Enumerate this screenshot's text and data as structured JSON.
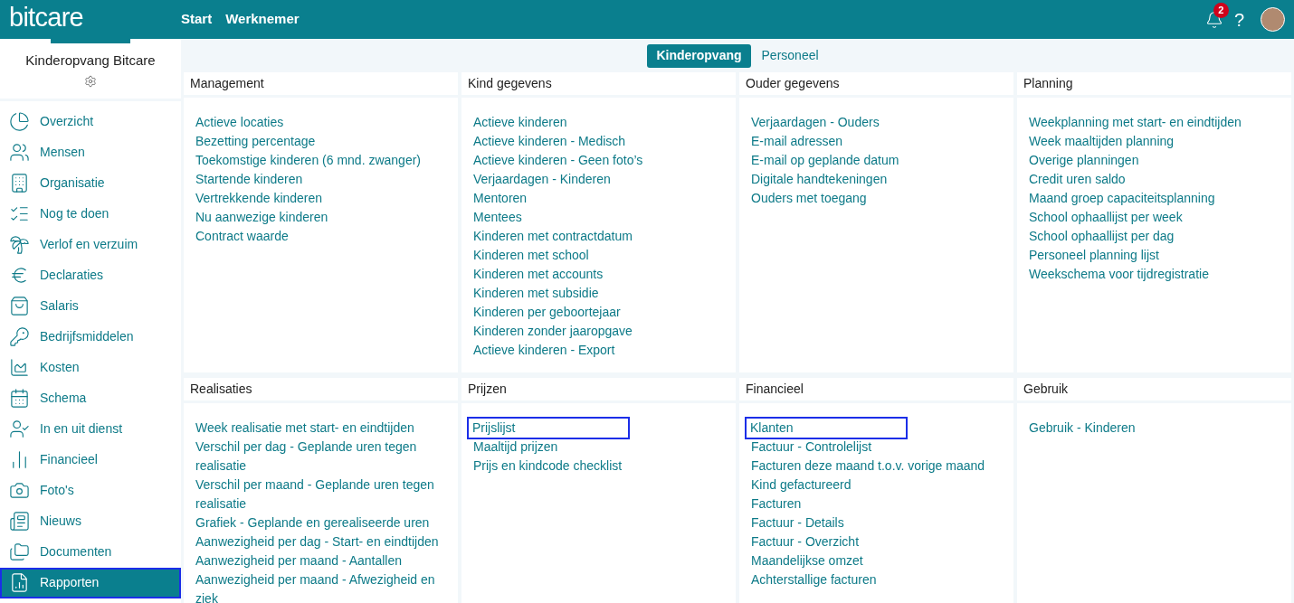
{
  "header": {
    "logo": "bitcare",
    "nav": [
      {
        "label": "Start"
      },
      {
        "label": "Werknemer"
      }
    ],
    "notifications": "2",
    "help": "?"
  },
  "sidebar": {
    "organisation": "Kinderopvang Bitcare",
    "items": [
      {
        "label": "Overzicht",
        "selected": false,
        "highlighted": false
      },
      {
        "label": "Mensen",
        "selected": false,
        "highlighted": false
      },
      {
        "label": "Organisatie",
        "selected": false,
        "highlighted": false
      },
      {
        "label": "Nog te doen",
        "selected": false,
        "highlighted": false
      },
      {
        "label": "Verlof en verzuim",
        "selected": false,
        "highlighted": false
      },
      {
        "label": "Declaraties",
        "selected": false,
        "highlighted": false
      },
      {
        "label": "Salaris",
        "selected": false,
        "highlighted": false
      },
      {
        "label": "Bedrijfsmiddelen",
        "selected": false,
        "highlighted": false
      },
      {
        "label": "Kosten",
        "selected": false,
        "highlighted": false
      },
      {
        "label": "Schema",
        "selected": false,
        "highlighted": false
      },
      {
        "label": "In en uit dienst",
        "selected": false,
        "highlighted": false
      },
      {
        "label": "Financieel",
        "selected": false,
        "highlighted": false
      },
      {
        "label": "Foto's",
        "selected": false,
        "highlighted": false
      },
      {
        "label": "Nieuws",
        "selected": false,
        "highlighted": false
      },
      {
        "label": "Documenten",
        "selected": false,
        "highlighted": false
      },
      {
        "label": "Rapporten",
        "selected": true,
        "highlighted": true
      }
    ]
  },
  "tabs": [
    {
      "label": "Kinderopvang",
      "selected": true
    },
    {
      "label": "Personeel",
      "selected": false
    }
  ],
  "panels": [
    {
      "title": "Management",
      "links": [
        {
          "label": "Actieve locaties",
          "highlighted": false
        },
        {
          "label": "Bezetting percentage",
          "highlighted": false
        },
        {
          "label": "Toekomstige kinderen (6 mnd. zwanger)",
          "highlighted": false
        },
        {
          "label": "Startende kinderen",
          "highlighted": false
        },
        {
          "label": "Vertrekkende kinderen",
          "highlighted": false
        },
        {
          "label": "Nu aanwezige kinderen",
          "highlighted": false
        },
        {
          "label": "Contract waarde",
          "highlighted": false
        }
      ]
    },
    {
      "title": "Kind gegevens",
      "links": [
        {
          "label": "Actieve kinderen",
          "highlighted": false
        },
        {
          "label": "Actieve kinderen - Medisch",
          "highlighted": false
        },
        {
          "label": "Actieve kinderen - Geen foto’s",
          "highlighted": false
        },
        {
          "label": "Verjaardagen - Kinderen",
          "highlighted": false
        },
        {
          "label": "Mentoren",
          "highlighted": false
        },
        {
          "label": "Mentees",
          "highlighted": false
        },
        {
          "label": "Kinderen met contractdatum",
          "highlighted": false
        },
        {
          "label": "Kinderen met school",
          "highlighted": false
        },
        {
          "label": "Kinderen met accounts",
          "highlighted": false
        },
        {
          "label": "Kinderen met subsidie",
          "highlighted": false
        },
        {
          "label": "Kinderen per geboortejaar",
          "highlighted": false
        },
        {
          "label": "Kinderen zonder jaaropgave",
          "highlighted": false
        },
        {
          "label": "Actieve kinderen - Export",
          "highlighted": false
        }
      ]
    },
    {
      "title": "Ouder gegevens",
      "links": [
        {
          "label": "Verjaardagen - Ouders",
          "highlighted": false
        },
        {
          "label": "E-mail adressen",
          "highlighted": false
        },
        {
          "label": "E-mail op geplande datum",
          "highlighted": false
        },
        {
          "label": "Digitale handtekeningen",
          "highlighted": false
        },
        {
          "label": "Ouders met toegang",
          "highlighted": false
        }
      ]
    },
    {
      "title": "Planning",
      "links": [
        {
          "label": "Weekplanning met start- en eindtijden",
          "highlighted": false
        },
        {
          "label": "Week maaltijden planning",
          "highlighted": false
        },
        {
          "label": "Overige planningen",
          "highlighted": false
        },
        {
          "label": "Credit uren saldo",
          "highlighted": false
        },
        {
          "label": "Maand groep capaciteitsplanning",
          "highlighted": false
        },
        {
          "label": "School ophaallijst per week",
          "highlighted": false
        },
        {
          "label": "School ophaallijst per dag",
          "highlighted": false
        },
        {
          "label": "Personeel planning lijst",
          "highlighted": false
        },
        {
          "label": "Weekschema voor tijdregistratie",
          "highlighted": false
        }
      ]
    },
    {
      "title": "Realisaties",
      "links": [
        {
          "label": "Week realisatie met start- en eindtijden",
          "highlighted": false
        },
        {
          "label": "Verschil per dag - Geplande uren tegen realisatie",
          "highlighted": false
        },
        {
          "label": "Verschil per maand - Geplande uren tegen realisatie",
          "highlighted": false
        },
        {
          "label": "Grafiek - Geplande en gerealiseerde uren",
          "highlighted": false
        },
        {
          "label": "Aanwezigheid per dag - Start- en eindtijden",
          "highlighted": false
        },
        {
          "label": "Aanwezigheid per maand - Aantallen",
          "highlighted": false
        },
        {
          "label": "Aanwezigheid per maand - Afwezigheid en ziek",
          "highlighted": false
        }
      ]
    },
    {
      "title": "Prijzen",
      "links": [
        {
          "label": "Prijslijst",
          "highlighted": true
        },
        {
          "label": "Maaltijd prijzen",
          "highlighted": false
        },
        {
          "label": "Prijs en kindcode checklist",
          "highlighted": false
        }
      ]
    },
    {
      "title": "Financieel",
      "links": [
        {
          "label": "Klanten",
          "highlighted": true
        },
        {
          "label": "Factuur - Controlelijst",
          "highlighted": false
        },
        {
          "label": "Facturen deze maand t.o.v. vorige maand",
          "highlighted": false
        },
        {
          "label": "Kind gefactureerd",
          "highlighted": false
        },
        {
          "label": "Facturen",
          "highlighted": false
        },
        {
          "label": "Factuur - Details",
          "highlighted": false
        },
        {
          "label": "Factuur - Overzicht",
          "highlighted": false
        },
        {
          "label": "Maandelijkse omzet",
          "highlighted": false
        },
        {
          "label": "Achterstallige facturen",
          "highlighted": false
        }
      ]
    },
    {
      "title": "Gebruik",
      "links": [
        {
          "label": "Gebruik - Kinderen",
          "highlighted": false
        }
      ]
    }
  ]
}
